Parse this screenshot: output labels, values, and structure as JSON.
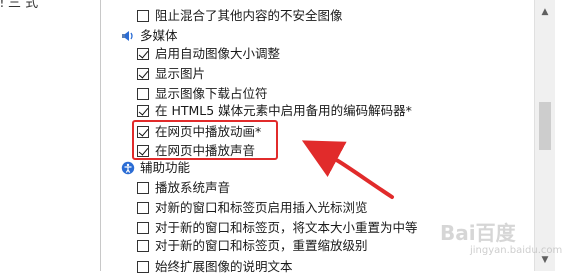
{
  "top_fragment": "ǃ 三 式",
  "items": [
    {
      "kind": "setting",
      "label": "阻止混合了其他内容的不安全图像",
      "checked": false
    },
    {
      "kind": "category",
      "label": "多媒体",
      "icon": "multimedia-icon"
    },
    {
      "kind": "setting",
      "label": "启用自动图像大小调整",
      "checked": true
    },
    {
      "kind": "setting",
      "label": "显示图片",
      "checked": true
    },
    {
      "kind": "setting",
      "label": "显示图像下载占位符",
      "checked": false
    },
    {
      "kind": "setting",
      "label": "在 HTML5 媒体元素中启用备用的编码解码器*",
      "checked": true
    },
    {
      "kind": "setting",
      "label": "在网页中播放动画*",
      "checked": true
    },
    {
      "kind": "setting",
      "label": "在网页中播放声音",
      "checked": true
    },
    {
      "kind": "category",
      "label": "辅助功能",
      "icon": "accessibility-icon"
    },
    {
      "kind": "setting",
      "label": "播放系统声音",
      "checked": false
    },
    {
      "kind": "setting",
      "label": "对新的窗口和标签页启用插入光标浏览",
      "checked": false
    },
    {
      "kind": "setting",
      "label": "对于新的窗口和标签页，将文本大小重置为中等",
      "checked": false
    },
    {
      "kind": "setting",
      "label": "对于新的窗口和标签页，重置缩放级别",
      "checked": false
    },
    {
      "kind": "setting",
      "label": "始终扩展图像的说明文本",
      "checked": false
    }
  ],
  "watermark": "Bai百度",
  "watermark_sub": "jingyan.baidu.com",
  "colors": {
    "highlight": "#e12b2b",
    "accent": "#2b6cd4"
  }
}
